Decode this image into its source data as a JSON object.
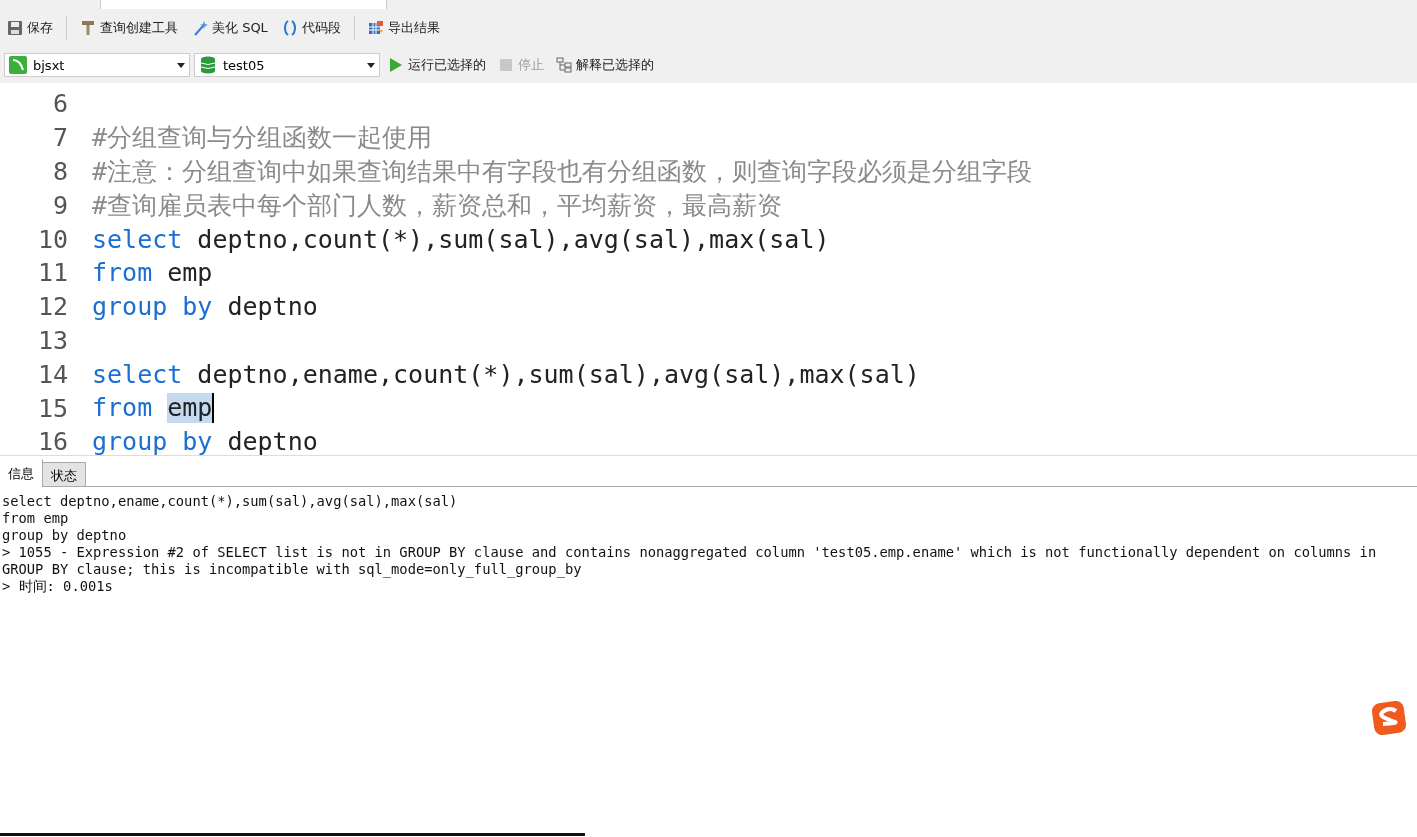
{
  "toolbar": [
    {
      "kind": "save",
      "label": "保存"
    },
    {
      "kind": "query-builder",
      "label": "查询创建工具"
    },
    {
      "kind": "beautify",
      "label": "美化 SQL"
    },
    {
      "kind": "snippet",
      "label": "代码段"
    },
    {
      "kind": "export",
      "label": "导出结果"
    }
  ],
  "connection": {
    "value": "bjsxt"
  },
  "database": {
    "value": "test05"
  },
  "actions": [
    {
      "kind": "run",
      "label": "运行已选择的",
      "disabled": false
    },
    {
      "kind": "stop",
      "label": "停止",
      "disabled": true
    },
    {
      "kind": "explain",
      "label": "解释已选择的",
      "disabled": false
    }
  ],
  "editor": {
    "lines": [
      {
        "number": "6"
      },
      {
        "number": "7",
        "tokens": [
          {
            "kind": "comment",
            "text": "#分组查询与分组函数一起使用"
          }
        ]
      },
      {
        "number": "8",
        "tokens": [
          {
            "kind": "comment",
            "text": "#注意：分组查询中如果查询结果中有字段也有分组函数，则查询字段必须是分组字段"
          }
        ]
      },
      {
        "number": "9",
        "tokens": [
          {
            "kind": "comment",
            "text": "#查询雇员表中每个部门人数，薪资总和，平均薪资，最高薪资"
          }
        ]
      },
      {
        "number": "10",
        "tokens": [
          {
            "kind": "keyword",
            "text": "select"
          },
          {
            "kind": "plain",
            "text": "deptno,count(*),sum(sal),avg(sal),max(sal)"
          }
        ]
      },
      {
        "number": "11",
        "tokens": [
          {
            "kind": "keyword",
            "text": "from"
          },
          {
            "kind": "plain",
            "text": "emp"
          }
        ]
      },
      {
        "number": "12",
        "tokens": [
          {
            "kind": "keyword",
            "text": "group by"
          },
          {
            "kind": "plain",
            "text": "deptno"
          }
        ]
      },
      {
        "number": "13"
      },
      {
        "number": "14",
        "tokens": [
          {
            "kind": "keyword",
            "text": "select"
          },
          {
            "kind": "plain",
            "text": "deptno,ename,count(*),sum(sal),avg(sal),max(sal)"
          }
        ]
      },
      {
        "number": "15",
        "tokens": [
          {
            "kind": "keyword",
            "text": "from"
          },
          {
            "kind": "selection",
            "text": "emp"
          }
        ]
      },
      {
        "number": "16",
        "tokens": [
          {
            "kind": "keyword",
            "text": "group by"
          },
          {
            "kind": "plain",
            "text": "deptno"
          }
        ]
      }
    ]
  },
  "result_tabs": [
    {
      "label": "信息",
      "selected": true
    },
    {
      "label": "状态",
      "selected": false
    }
  ],
  "messages": [
    "select deptno,ename,count(*),sum(sal),avg(sal),max(sal)",
    "from emp",
    "group by deptno",
    "> 1055 - Expression #2 of SELECT list is not in GROUP BY clause and contains nonaggregated column 'test05.emp.ename' which is not functionally dependent on columns in GROUP BY clause; this is incompatible with sql_mode=only_full_group_by",
    "> 时间: 0.001s"
  ]
}
